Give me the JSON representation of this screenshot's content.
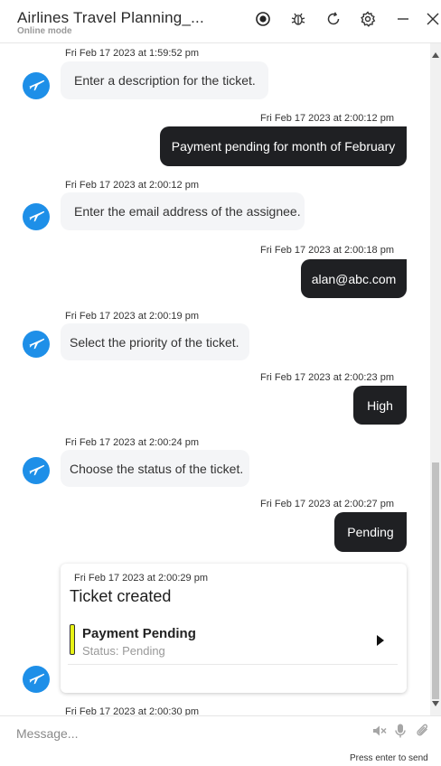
{
  "header": {
    "title": "Airlines Travel Planning_...",
    "subtitle": "Online mode"
  },
  "messages": [
    {
      "from": "bot",
      "timestamp": "Fri Feb 17 2023 at 1:59:52 pm",
      "text": "Enter a description for the ticket."
    },
    {
      "from": "user",
      "timestamp": "Fri Feb 17 2023 at 2:00:12 pm",
      "text": "Payment pending for month of February"
    },
    {
      "from": "bot",
      "timestamp": "Fri Feb 17 2023 at 2:00:12 pm",
      "text": "Enter the email address of the assignee."
    },
    {
      "from": "user",
      "timestamp": "Fri Feb 17 2023 at 2:00:18 pm",
      "text": "alan@abc.com"
    },
    {
      "from": "bot",
      "timestamp": "Fri Feb 17 2023 at 2:00:19 pm",
      "text": "Select the priority of the ticket."
    },
    {
      "from": "user",
      "timestamp": "Fri Feb 17 2023 at 2:00:23 pm",
      "text": "High"
    },
    {
      "from": "bot",
      "timestamp": "Fri Feb 17 2023 at 2:00:24 pm",
      "text": "Choose the status of the ticket."
    },
    {
      "from": "user",
      "timestamp": "Fri Feb 17 2023 at 2:00:27 pm",
      "text": "Pending"
    }
  ],
  "ticket_card": {
    "timestamp": "Fri Feb 17 2023 at 2:00:29 pm",
    "title": "Ticket created",
    "item_title": "Payment Pending",
    "item_status": "Status: Pending",
    "status_color": "#e8f215"
  },
  "last_timestamp": "Fri Feb 17 2023 at 2:00:30 pm",
  "composer": {
    "placeholder": "Message...",
    "hint": "Press enter to send"
  },
  "colors": {
    "user_bubble": "#1f2023",
    "bot_bubble": "#f4f5f7",
    "avatar": "#1e8fe8"
  },
  "icons": [
    "record-icon",
    "bug-icon",
    "refresh-icon",
    "settings-icon",
    "minimize-icon",
    "close-icon",
    "airplane-icon",
    "speaker-muted-icon",
    "microphone-icon",
    "paperclip-icon"
  ]
}
